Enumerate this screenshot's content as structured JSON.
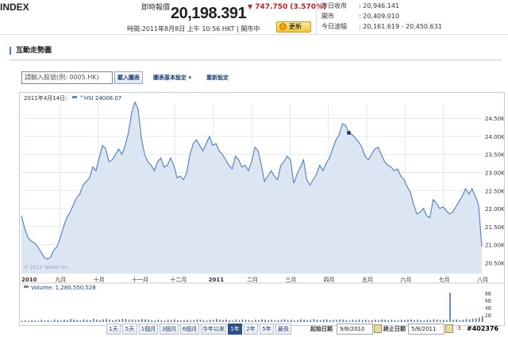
{
  "header": {
    "index_label": "INDEX",
    "realtime_label": "即時報價",
    "price": "20,198.391",
    "change_arrow": "▼",
    "change": "747.750 (3.570%)",
    "time_text": "時間:2011年8月8日 上午 10:56 HKT | 開市中",
    "refresh_label": "更新",
    "stats": [
      {
        "label": "昨日收市",
        "value": ": 20,946.141"
      },
      {
        "label": "開市",
        "value": ": 20,409.010"
      },
      {
        "label": "今日波幅",
        "value": ": 20,161.619 - 20,450.631"
      }
    ]
  },
  "section": {
    "title": "互動走勢圖"
  },
  "toolbar": {
    "symbol_placeholder": "請輸入股號(例: 0005.HK)",
    "load_chart": "載入圖表",
    "basic_settings": "圖表基本設定",
    "reset_settings": "重新設定"
  },
  "chart": {
    "date_label": "2011年4月14日:",
    "series_label": "^HSI 24008.07",
    "watermark": "© 2011 Yahoo! Inc.",
    "y_ticks": [
      "24.50K",
      "24.00K",
      "23.50K",
      "23.00K",
      "22.50K",
      "22.00K",
      "21.50K",
      "21.00K",
      "20.50K"
    ],
    "x_ticks": [
      {
        "label": "2010",
        "bold": true
      },
      {
        "label": "九月"
      },
      {
        "label": "十月"
      },
      {
        "label": "十一月"
      },
      {
        "label": "十二月"
      },
      {
        "label": "2011",
        "bold": true
      },
      {
        "label": "二月"
      },
      {
        "label": "三月"
      },
      {
        "label": "四月"
      },
      {
        "label": "五月"
      },
      {
        "label": "六月"
      },
      {
        "label": "七月"
      },
      {
        "label": "八月"
      }
    ],
    "volume_label": "Volume: 1,280,550,528",
    "volume_ticks": [
      "8B",
      "6B",
      "4B",
      "2B"
    ],
    "accent": "#5b86c0",
    "fill": "#dbe6f2"
  },
  "chart_data": {
    "type": "area",
    "title": "",
    "ylim": [
      20200,
      24900
    ],
    "y_ticks": [
      24500,
      24000,
      23500,
      23000,
      22500,
      22000,
      21500,
      21000,
      20500
    ],
    "series": [
      {
        "name": "^HSI",
        "values": [
          21800,
          21450,
          21200,
          21100,
          21050,
          20950,
          20800,
          20650,
          20600,
          20650,
          20850,
          20950,
          21200,
          21500,
          21750,
          21900,
          22100,
          22300,
          22400,
          22650,
          22750,
          22850,
          23150,
          23050,
          23400,
          23750,
          23650,
          23300,
          23350,
          23500,
          23650,
          23500,
          23750,
          24100,
          24650,
          24950,
          24750,
          23950,
          23500,
          23300,
          23200,
          23050,
          23300,
          23400,
          23150,
          23200,
          23400,
          23200,
          22850,
          22900,
          22800,
          23000,
          23500,
          23800,
          23900,
          23750,
          23600,
          23800,
          24000,
          23750,
          23800,
          23600,
          23500,
          23350,
          23200,
          23100,
          23450,
          23350,
          23150,
          23200,
          23050,
          23300,
          23700,
          23600,
          23200,
          22750,
          22900,
          23050,
          22900,
          22800,
          23200,
          23300,
          23450,
          23350,
          22700,
          22950,
          23150,
          23350,
          22800,
          22650,
          22800,
          22950,
          23200,
          23050,
          23250,
          23400,
          23650,
          23900,
          24050,
          24350,
          24300,
          24100,
          24050,
          23950,
          23850,
          23700,
          23450,
          23350,
          23500,
          23650,
          23700,
          23500,
          23300,
          23200,
          23150,
          23050,
          23100,
          22900,
          22800,
          22600,
          22450,
          22100,
          21850,
          21900,
          22000,
          21800,
          21750,
          22250,
          22150,
          22000,
          22050,
          21950,
          21850,
          21900,
          22050,
          22200,
          22350,
          22550,
          22400,
          22550,
          22350,
          22100,
          20950
        ]
      }
    ],
    "volume_series": [
      0.3,
      0.4,
      0.3,
      0.5,
      0.4,
      0.3,
      0.6,
      0.4,
      0.5,
      0.3,
      0.7,
      0.5,
      0.4,
      0.6,
      0.5,
      0.8,
      0.6,
      0.5,
      0.4,
      0.7,
      0.6,
      0.5,
      0.9,
      0.6,
      0.5,
      0.7,
      0.8,
      0.6,
      0.5,
      0.6,
      0.7,
      0.9,
      0.8,
      0.6,
      0.7,
      0.5,
      0.6,
      0.8,
      0.7,
      0.6,
      0.5,
      0.4,
      0.6,
      0.5,
      0.4,
      0.6,
      0.5,
      0.7,
      0.5,
      0.4,
      0.5,
      0.6,
      0.4,
      0.5,
      0.7,
      0.6,
      0.5,
      0.4,
      0.6,
      0.5,
      0.8,
      0.6,
      0.5,
      0.7,
      0.5,
      0.4,
      0.6,
      0.5,
      0.7,
      0.6,
      0.5,
      0.4,
      0.6,
      0.5,
      0.7,
      0.6,
      0.5,
      0.6,
      0.4,
      0.5,
      0.6,
      0.7,
      0.5,
      0.6,
      0.4,
      0.5,
      0.7,
      0.6,
      0.5,
      0.6,
      0.8,
      0.6,
      0.5,
      0.6,
      0.7,
      0.5,
      0.6,
      0.5,
      0.7,
      0.6,
      0.5,
      0.4,
      0.6,
      0.5,
      0.7,
      0.5,
      0.6,
      0.4,
      0.5,
      0.6,
      0.5,
      0.7,
      0.6,
      0.5,
      0.6,
      0.5,
      0.4,
      0.6,
      0.5,
      0.6,
      0.7,
      0.5,
      0.6,
      0.5,
      0.4,
      0.6,
      0.5,
      0.7,
      0.6,
      0.5,
      0.6,
      0.5,
      8.0,
      0.6,
      0.7,
      0.5,
      0.6,
      0.8,
      0.7,
      0.9,
      1.0,
      1.2,
      1.6
    ]
  },
  "footer": {
    "ranges": [
      "1天",
      "5天",
      "1個月",
      "3個月",
      "6個月",
      "今年以來",
      "1年",
      "2年",
      "5年",
      "最長"
    ],
    "selected": "1年",
    "start_label": "起始日期",
    "start_value": "9/8/2010",
    "end_label": "終止日期",
    "end_value": "5/8/2011",
    "neg_text": "-3.",
    "watermark": "#402376"
  }
}
